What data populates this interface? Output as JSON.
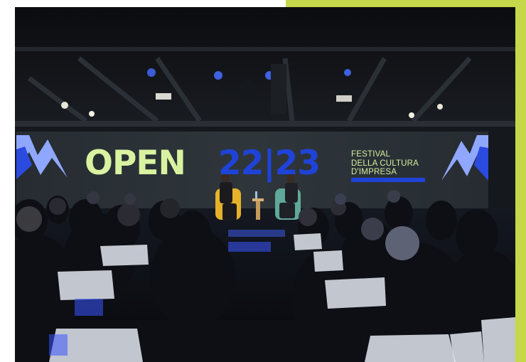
{
  "screen": {
    "wordmark": "OPEN",
    "edition": "22|23",
    "festival_lines": [
      "FESTIVAL",
      "DELLA CULTURA",
      "D'IMPRESA"
    ]
  },
  "colors": {
    "accent_frame": "#c5d84a",
    "wordmark": "#d9f2a0",
    "edition": "#1f43d8",
    "screen_bg": "#2c3338"
  }
}
